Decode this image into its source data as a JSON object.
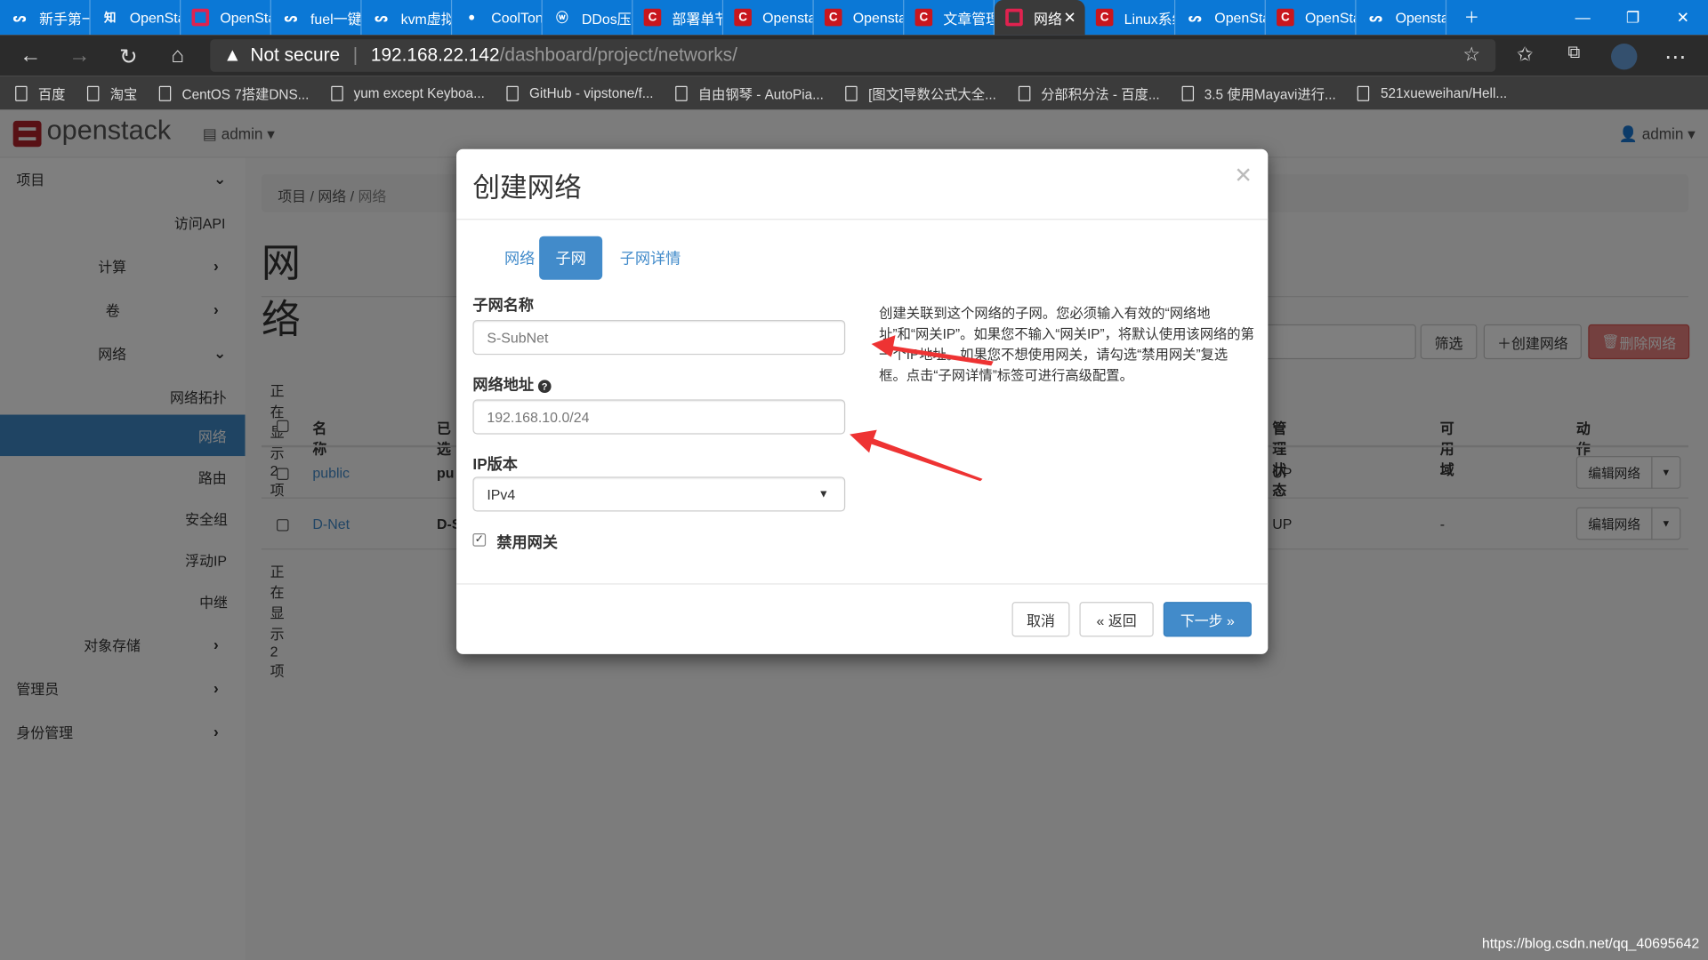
{
  "browser": {
    "tabs": [
      {
        "title": "新手第一",
        "icon": "kvm-logo-icon"
      },
      {
        "title": "OpenSta",
        "icon": "zhihu-icon"
      },
      {
        "title": "OpenSta",
        "icon": "openstack-icon"
      },
      {
        "title": "fuel一键",
        "icon": "kvm-logo-icon"
      },
      {
        "title": "kvm虚拟",
        "icon": "kvm-logo-icon"
      },
      {
        "title": "CoolTon",
        "icon": "github-icon"
      },
      {
        "title": "DDos压",
        "icon": "wordpress-icon"
      },
      {
        "title": "部署单节",
        "icon": "csdn-icon"
      },
      {
        "title": "Opensta",
        "icon": "csdn-icon"
      },
      {
        "title": "Opensta",
        "icon": "csdn-icon"
      },
      {
        "title": "文章管理",
        "icon": "csdn-icon"
      },
      {
        "title": "网络",
        "icon": "openstack-icon",
        "active": true
      },
      {
        "title": "Linux系统",
        "icon": "csdn-icon"
      },
      {
        "title": "OpenSta",
        "icon": "kvm-logo-icon"
      },
      {
        "title": "OpenSta",
        "icon": "csdn-icon"
      },
      {
        "title": "Opensta",
        "icon": "kvm-logo-icon"
      }
    ],
    "security": "Not secure",
    "url_host": "192.168.22.142",
    "url_path": "/dashboard/project/networks/",
    "bookmarks": [
      "百度",
      "淘宝",
      "CentOS 7搭建DNS...",
      "yum except Keyboa...",
      "GitHub - vipstone/f...",
      "自由钢琴 - AutoPia...",
      "[图文]导数公式大全...",
      "分部积分法 - 百度...",
      "3.5 使用Mayavi进行...",
      "521xueweihan/Hell..."
    ]
  },
  "header": {
    "brand": "openstack",
    "project": "admin",
    "user": "admin"
  },
  "sidebar": {
    "items": [
      "项目",
      "访问API",
      "计算",
      "卷",
      "网络",
      "网络拓扑",
      "网络",
      "路由",
      "安全组",
      "浮动IP",
      "中继",
      "对象存储",
      "管理员",
      "身份管理"
    ]
  },
  "main": {
    "breadcrumb": [
      "项目",
      "网络",
      "网络"
    ],
    "title": "网络",
    "filter_label": "筛选",
    "create_label": "创建网络",
    "delete_label": "删除网络",
    "count": "正在显示 2 项",
    "columns": [
      "名称",
      "已选",
      "管理状态",
      "可用域",
      "动作"
    ],
    "rows": [
      {
        "name": "public",
        "shared": "pu",
        "admin_state": "UP",
        "zone": "-",
        "action": "编辑网络"
      },
      {
        "name": "D-Net",
        "shared": "D-S",
        "admin_state": "UP",
        "zone": "-",
        "action": "编辑网络"
      }
    ]
  },
  "modal": {
    "title": "创建网络",
    "tabs": [
      "网络",
      "子网",
      "子网详情"
    ],
    "active_tab": "子网",
    "subnet_name_label": "子网名称",
    "subnet_name_value": "S-SubNet",
    "network_address_label": "网络地址",
    "network_address_value": "192.168.10.0/24",
    "ip_version_label": "IP版本",
    "ip_version_value": "IPv4",
    "disable_gateway_label": "禁用网关",
    "disable_gateway_checked": true,
    "help": "创建关联到这个网络的子网。您必须输入有效的“网络地址”和“网关IP”。如果您不输入“网关IP”，将默认使用该网络的第一个IP地址。如果您不想使用网关，请勾选“禁用网关”复选框。点击“子网详情”标签可进行高级配置。",
    "cancel": "取消",
    "back": "« 返回",
    "next": "下一步 »"
  },
  "watermark": "https://blog.csdn.net/qq_40695642",
  "colors": {
    "primary": "#428bca",
    "danger": "#d9534f",
    "tabbar": "#0b78d6",
    "annotation_arrow": "#ee3333"
  }
}
